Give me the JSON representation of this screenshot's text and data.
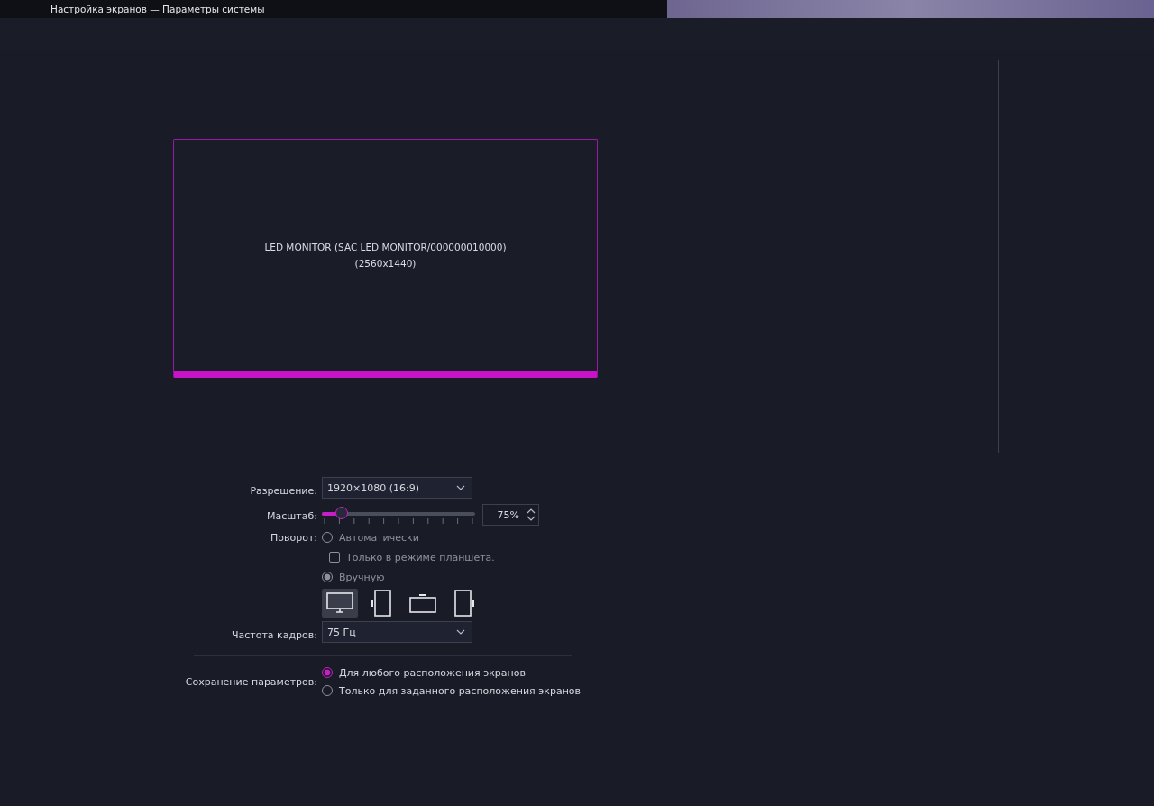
{
  "window": {
    "title": "Настройка экранов — Параметры системы"
  },
  "arrangement": {
    "screens": [
      {
        "name": "LED MONITOR (SAC LED MONITOR/000000010000)",
        "resolution": "(2560x1440)",
        "selected": true
      }
    ]
  },
  "resolution": {
    "label": "Разрешение:",
    "value": "1920×1080 (16:9)"
  },
  "scale": {
    "label": "Масштаб:",
    "level": 0.13,
    "value": "75%"
  },
  "rotation": {
    "label": "Поворот:",
    "disabled": true,
    "auto": {
      "label": "Автоматически",
      "selected": false
    },
    "tablet_only": {
      "label": "Только в режиме планшета.",
      "checked": false
    },
    "manual": {
      "label": "Вручную",
      "selected": true
    },
    "orientations": [
      {
        "kind": "landscape",
        "selected": true
      },
      {
        "kind": "portrait-left",
        "selected": false
      },
      {
        "kind": "landscape-flipped",
        "selected": false
      },
      {
        "kind": "portrait-right",
        "selected": false
      }
    ]
  },
  "refresh_rate": {
    "label": "Частота кадров:",
    "value": "75 Гц"
  },
  "save_settings": {
    "label": "Сохранение параметров:",
    "options": [
      {
        "label": "Для любого расположения экранов",
        "selected": true
      },
      {
        "label": "Только для заданного расположения экранов",
        "selected": false
      }
    ]
  }
}
